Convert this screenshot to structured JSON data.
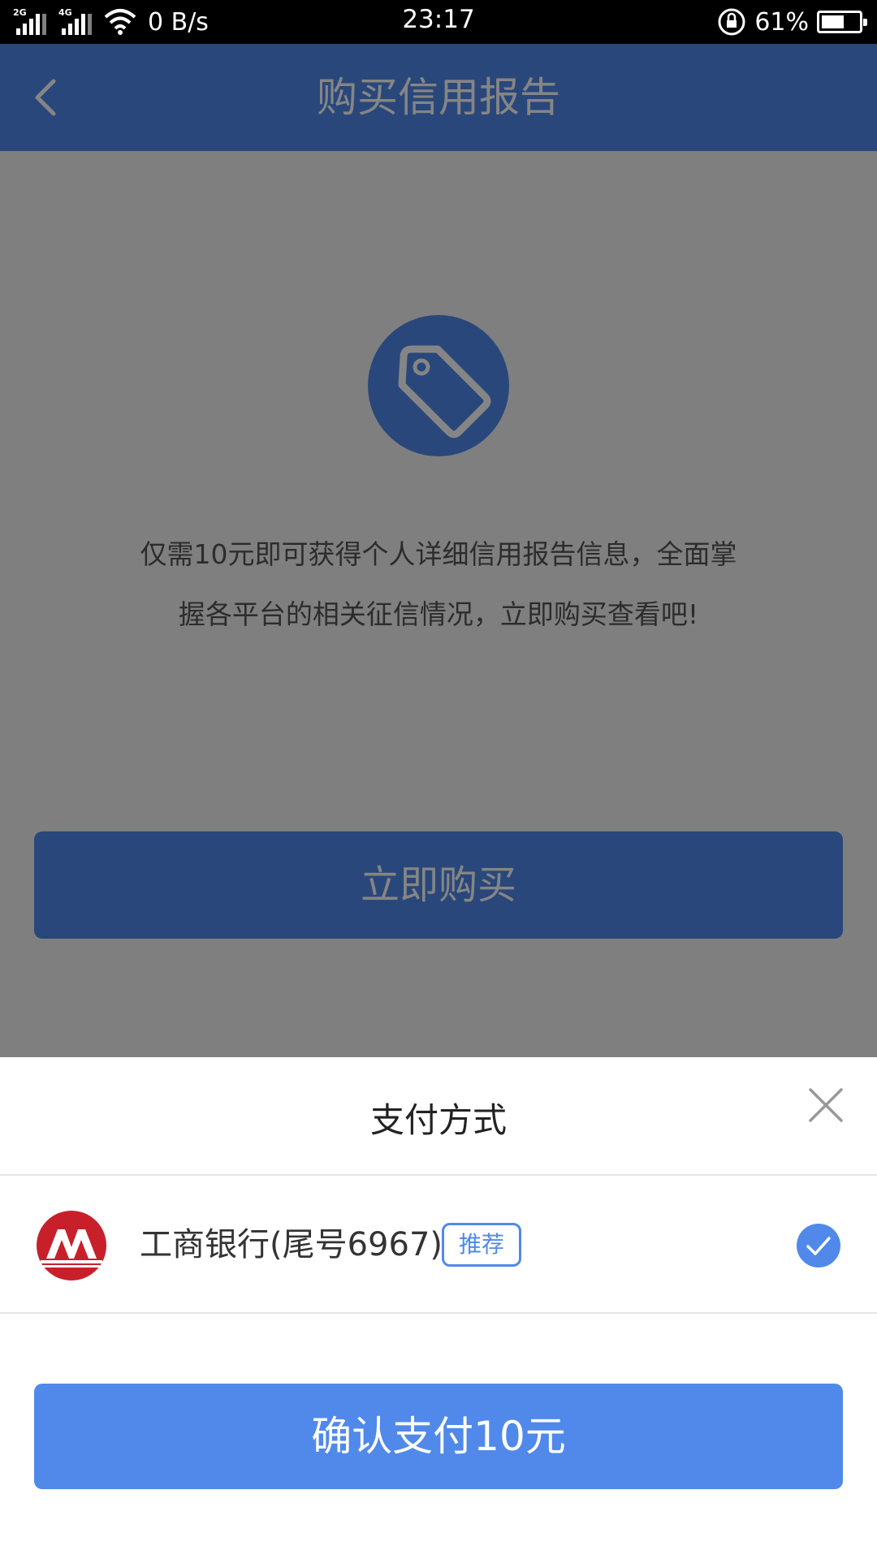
{
  "status_bar": {
    "net_type_1": "2G",
    "net_type_2": "4G",
    "net_speed": "0 B/s",
    "time": "23:17",
    "battery_percent": "61%",
    "battery_level": 0.61
  },
  "header": {
    "title": "购买信用报告",
    "back_icon": "chevron-left-icon"
  },
  "main": {
    "icon": "price-tag-icon",
    "description_line1": "仅需10元即可获得个人详细信用报告信息，全面掌",
    "description_line2": "握各平台的相关征信情况，立即购买查看吧!",
    "buy_label": "立即购买"
  },
  "payment_sheet": {
    "title": "支付方式",
    "close_icon": "close-icon",
    "method": {
      "bank_name": "工商银行(尾号6967)",
      "badge": "推荐",
      "selected": true,
      "logo_icon": "bank-logo-icon"
    },
    "confirm_label": "确认支付10元"
  },
  "colors": {
    "accent": "#5089ea",
    "bank_logo": "#c8202a",
    "status_bar": "#000000"
  }
}
